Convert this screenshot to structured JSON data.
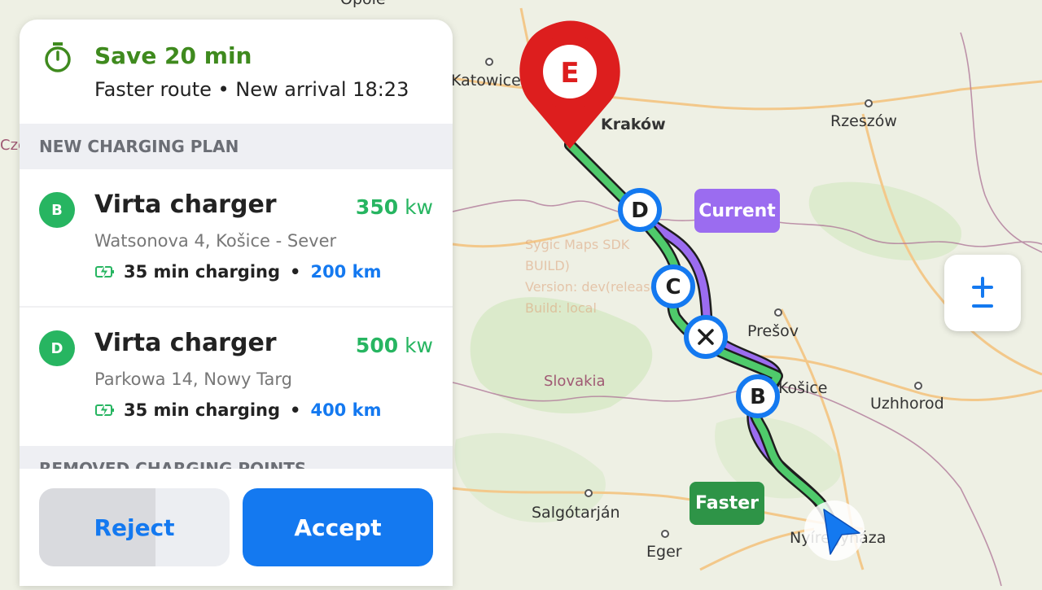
{
  "banner": {
    "title": "Save 20 min",
    "subtitle": "Faster route • New arrival 18:23",
    "icon": "stopwatch-icon",
    "accent": "#3f8a1e"
  },
  "plan": {
    "section_title": "NEW CHARGING PLAN",
    "chargers": [
      {
        "badge": "B",
        "name": "Virta charger",
        "power_value": "350",
        "power_unit": "kw",
        "address": "Watsonova 4, Košice - Sever",
        "charging_time": "35 min charging",
        "separator": "•",
        "distance": "200 km"
      },
      {
        "badge": "D",
        "name": "Virta charger",
        "power_value": "500",
        "power_unit": "kw",
        "address": "Parkowa 14, Nowy Targ",
        "charging_time": "35 min charging",
        "separator": "•",
        "distance": "400 km"
      }
    ],
    "removed_title": "REMOVED CHARGING POINTS"
  },
  "actions": {
    "reject_label": "Reject",
    "reject_progress": 0.61,
    "accept_label": "Accept"
  },
  "map": {
    "cities": [
      "Katowice",
      "Kraków",
      "Rzeszów",
      "Prešov",
      "Košice",
      "Uzhhorod",
      "Salgótarján",
      "Eger",
      "Nyíregyháza",
      "Opole"
    ],
    "countries": [
      "Slovakia",
      "Czechia"
    ],
    "watermark": [
      "Sygic Maps SDK",
      "BUILD)",
      "Version: dev(release)",
      "Build: local"
    ],
    "route_labels": {
      "current": "Current",
      "faster": "Faster"
    },
    "markers": {
      "destination": "E",
      "waypoints": [
        "D",
        "C",
        "B"
      ]
    },
    "colors": {
      "faster_route": "#4fca6b",
      "current_route": "#9b6cf0",
      "marker": "#1479f0",
      "destination": "#dd1e1e"
    }
  }
}
